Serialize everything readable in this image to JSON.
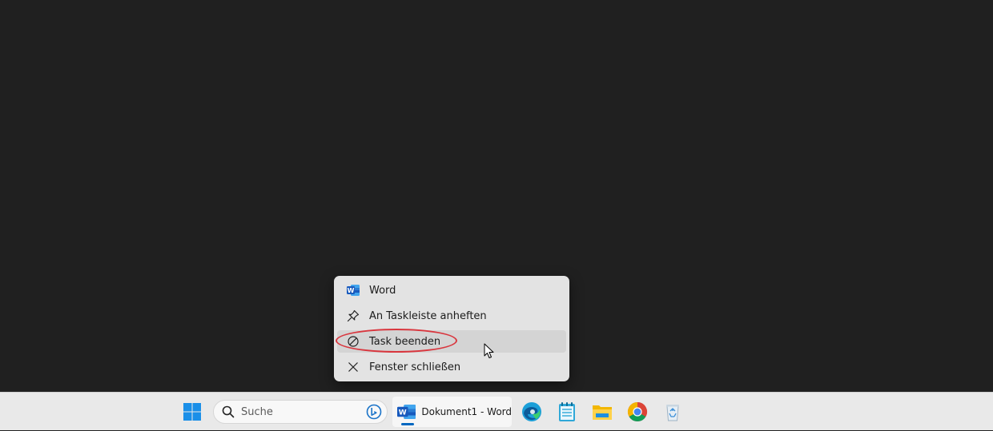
{
  "context_menu": {
    "items": [
      {
        "label": "Word",
        "icon": "word-app-icon"
      },
      {
        "label": "An Taskleiste anheften",
        "icon": "pin-icon"
      },
      {
        "label": "Task beenden",
        "icon": "end-task-icon",
        "state": "hover"
      },
      {
        "label": "Fenster schließen",
        "icon": "close-icon"
      }
    ]
  },
  "taskbar": {
    "search": {
      "placeholder": "Suche"
    },
    "active_task": {
      "label": "Dokument1 - Word"
    },
    "pinned": [
      "start-icon",
      "edge-icon",
      "notepad-icon",
      "file-explorer-icon",
      "chrome-icon",
      "recycle-bin-icon"
    ]
  },
  "colors": {
    "desktop": "#202020",
    "menu_bg": "#e3e3e3",
    "highlight_ring": "#d9363e",
    "accent": "#0067c0"
  }
}
